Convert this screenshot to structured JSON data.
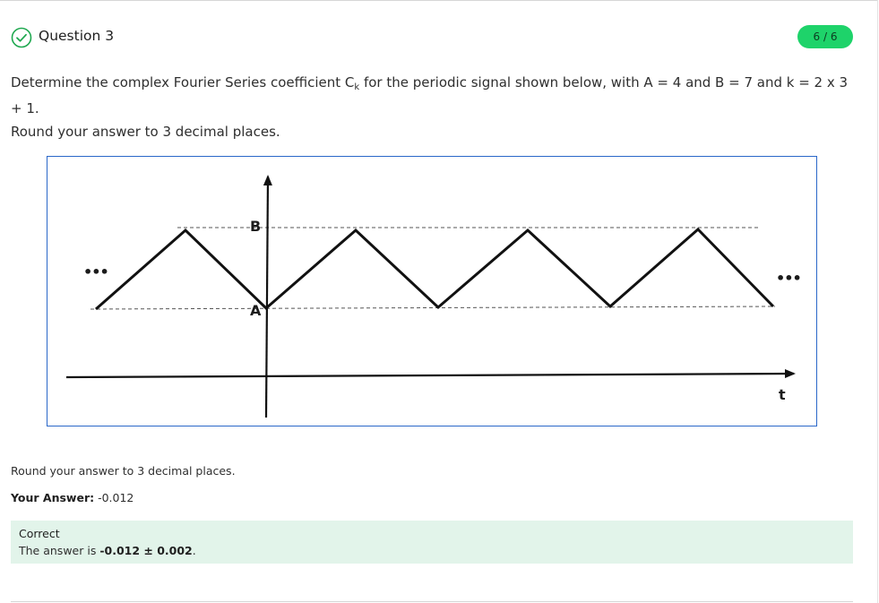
{
  "question": {
    "title": "Question 3",
    "score": "6 / 6",
    "prompt_part1": "Determine the complex Fourier Series coefficient C",
    "prompt_subscript": "k",
    "prompt_part2": " for the periodic signal shown below, with A = 4 and B = 7 and k = 2 x 3 + 1.",
    "prompt_round": "Round your answer to 3 decimal places."
  },
  "figure": {
    "label_b": "B",
    "label_a": "A",
    "label_t": "t",
    "ellipsis_left": "•••",
    "ellipsis_right": "•••"
  },
  "answer": {
    "round_note": "Round your answer to 3 decimal places.",
    "your_answer_label": "Your Answer:",
    "your_answer_value": " -0.012"
  },
  "feedback": {
    "status": "Correct",
    "text_prefix": "The answer is ",
    "correct_value": "-0.012 ± 0.002",
    "text_suffix": "."
  },
  "colors": {
    "badge": "#1ed36a",
    "check": "#1ea84f",
    "feedback_bg": "#e2f4ea",
    "figure_border": "#2a67c9"
  }
}
